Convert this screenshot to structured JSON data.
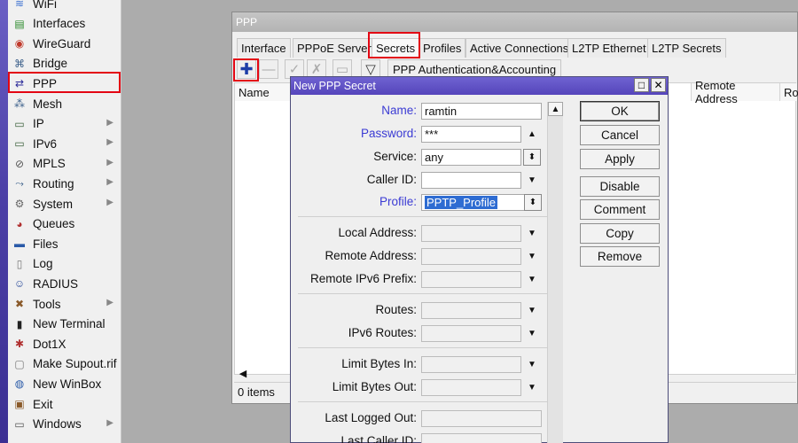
{
  "sidebar": {
    "items": [
      {
        "label": "WiFi",
        "icon": "wifi-icon",
        "glyph": "≋",
        "color": "#3a6fd0",
        "arrow": false
      },
      {
        "label": "Interfaces",
        "icon": "interfaces-icon",
        "glyph": "▤",
        "color": "#2b8a2b",
        "arrow": false
      },
      {
        "label": "WireGuard",
        "icon": "wireguard-icon",
        "glyph": "◉",
        "color": "#c0392b",
        "arrow": false
      },
      {
        "label": "Bridge",
        "icon": "bridge-icon",
        "glyph": "⌘",
        "color": "#3b5f8a",
        "arrow": false
      },
      {
        "label": "PPP",
        "icon": "ppp-icon",
        "glyph": "⇄",
        "color": "#2a2a9a",
        "arrow": false
      },
      {
        "label": "Mesh",
        "icon": "mesh-icon",
        "glyph": "⁂",
        "color": "#3b5f8a",
        "arrow": false
      },
      {
        "label": "IP",
        "icon": "ip-icon",
        "glyph": "▭",
        "color": "#3a5f3a",
        "arrow": true
      },
      {
        "label": "IPv6",
        "icon": "ipv6-icon",
        "glyph": "▭",
        "color": "#3a5f3a",
        "arrow": true
      },
      {
        "label": "MPLS",
        "icon": "mpls-icon",
        "glyph": "⊘",
        "color": "#555555",
        "arrow": true
      },
      {
        "label": "Routing",
        "icon": "routing-icon",
        "glyph": "⤳",
        "color": "#3b5f8a",
        "arrow": true
      },
      {
        "label": "System",
        "icon": "system-gear-icon",
        "glyph": "⚙",
        "color": "#666666",
        "arrow": true
      },
      {
        "label": "Queues",
        "icon": "queues-icon",
        "glyph": "◕",
        "color": "#b03030",
        "arrow": false
      },
      {
        "label": "Files",
        "icon": "files-icon",
        "glyph": "▬",
        "color": "#2a5aa8",
        "arrow": false
      },
      {
        "label": "Log",
        "icon": "log-icon",
        "glyph": "▯",
        "color": "#777777",
        "arrow": false
      },
      {
        "label": "RADIUS",
        "icon": "radius-icon",
        "glyph": "☺",
        "color": "#2a4a9a",
        "arrow": false
      },
      {
        "label": "Tools",
        "icon": "tools-icon",
        "glyph": "✖",
        "color": "#8a5a2a",
        "arrow": true
      },
      {
        "label": "New Terminal",
        "icon": "terminal-icon",
        "glyph": "▮",
        "color": "#222222",
        "arrow": false
      },
      {
        "label": "Dot1X",
        "icon": "dot1x-icon",
        "glyph": "✱",
        "color": "#b03030",
        "arrow": false
      },
      {
        "label": "Make Supout.rif",
        "icon": "supout-icon",
        "glyph": "▢",
        "color": "#777777",
        "arrow": false
      },
      {
        "label": "New WinBox",
        "icon": "winbox-icon",
        "glyph": "◍",
        "color": "#2a5aa8",
        "arrow": false
      },
      {
        "label": "Exit",
        "icon": "exit-icon",
        "glyph": "▣",
        "color": "#8a5a2a",
        "arrow": false
      },
      {
        "label": "Windows",
        "icon": "windows-icon",
        "glyph": "▭",
        "color": "#555555",
        "arrow": true
      }
    ]
  },
  "ppp_window": {
    "title": "PPP",
    "tabs": [
      "Interface",
      "PPPoE Servers",
      "Secrets",
      "Profiles",
      "Active Connections",
      "L2TP Ethernet",
      "L2TP Secrets"
    ],
    "active_tab": "Secrets",
    "auth_button": "PPP Authentication&Accounting",
    "columns": [
      "Name",
      "Remote Address",
      "Rou"
    ],
    "status": "0 items"
  },
  "dialog": {
    "title": "New PPP Secret",
    "fields": [
      {
        "label": "Name:",
        "value": "ramtin"
      },
      {
        "label": "Password:",
        "value": "***"
      },
      {
        "label": "Service:",
        "value": "any"
      },
      {
        "label": "Caller ID:",
        "value": ""
      },
      {
        "label": "Profile:",
        "value": "PPTP_Profile"
      },
      {
        "label": "Local Address:",
        "value": ""
      },
      {
        "label": "Remote Address:",
        "value": ""
      },
      {
        "label": "Remote IPv6 Prefix:",
        "value": ""
      },
      {
        "label": "Routes:",
        "value": ""
      },
      {
        "label": "IPv6 Routes:",
        "value": ""
      },
      {
        "label": "Limit Bytes In:",
        "value": ""
      },
      {
        "label": "Limit Bytes Out:",
        "value": ""
      },
      {
        "label": "Last Logged Out:",
        "value": ""
      },
      {
        "label": "Last Caller ID:",
        "value": ""
      }
    ],
    "buttons": {
      "ok": "OK",
      "cancel": "Cancel",
      "apply": "Apply",
      "disable": "Disable",
      "comment": "Comment",
      "copy": "Copy",
      "remove": "Remove"
    }
  },
  "colors": {
    "highlight": "#e30613",
    "dialog_title": "#5545bb",
    "field_label_blue": "#3b3bd4",
    "selection": "#2e6cd2"
  }
}
